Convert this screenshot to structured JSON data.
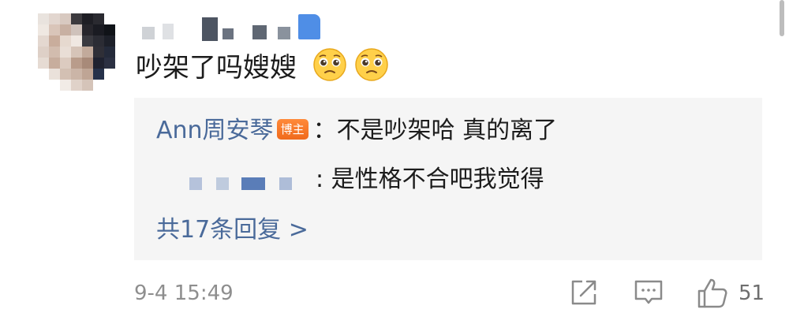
{
  "comment": {
    "text": "吵架了吗嫂嫂",
    "emoji_icon": "pleading-face-emoji"
  },
  "replies": [
    {
      "author": "Ann周安琴",
      "badge": "博主",
      "text": "：不是吵架哈 真的离了"
    },
    {
      "author_visible": false,
      "text": ": 是性格不合吧我觉得"
    }
  ],
  "more_replies_label": "共17条回复 >",
  "footer": {
    "timestamp": "9-4 15:49",
    "like_count": "51",
    "icons": [
      "share-icon",
      "comment-icon",
      "like-icon"
    ]
  },
  "colors": {
    "link": "#4a6a9a",
    "badge": "#f06a1c",
    "reply_bg": "#f5f5f5",
    "meta": "#8e8e8e"
  }
}
